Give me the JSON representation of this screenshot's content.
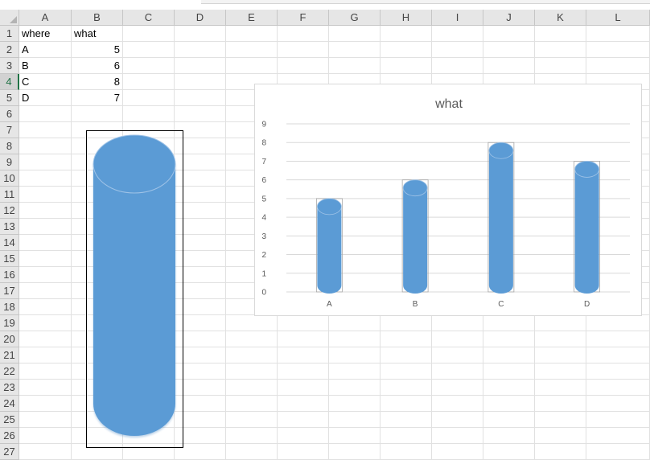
{
  "columns": [
    "A",
    "B",
    "C",
    "D",
    "E",
    "F",
    "G",
    "H",
    "I",
    "J",
    "K",
    "L"
  ],
  "rows": [
    "1",
    "2",
    "3",
    "4",
    "5",
    "6",
    "7",
    "8",
    "9",
    "10",
    "11",
    "12",
    "13",
    "14",
    "15",
    "16",
    "17",
    "18",
    "19",
    "20",
    "21",
    "22",
    "23",
    "24",
    "25",
    "26",
    "27"
  ],
  "active_row": "4",
  "cells": [
    {
      "ref": "A1",
      "text": "where",
      "type": "text"
    },
    {
      "ref": "B1",
      "text": "what",
      "type": "text"
    },
    {
      "ref": "A2",
      "text": "A",
      "type": "text"
    },
    {
      "ref": "B2",
      "text": "5",
      "type": "num"
    },
    {
      "ref": "A3",
      "text": "B",
      "type": "text"
    },
    {
      "ref": "B3",
      "text": "6",
      "type": "num"
    },
    {
      "ref": "A4",
      "text": "C",
      "type": "text"
    },
    {
      "ref": "B4",
      "text": "8",
      "type": "num"
    },
    {
      "ref": "A5",
      "text": "D",
      "type": "text"
    },
    {
      "ref": "B5",
      "text": "7",
      "type": "num"
    }
  ],
  "colors": {
    "bar_fill": "#5b9bd5",
    "bar_top": "#6aa6dc",
    "grid": "#d9d9d9",
    "text": "#595959"
  },
  "chart_data": {
    "type": "bar",
    "bar_shape": "cylinder",
    "title": "what",
    "categories": [
      "A",
      "B",
      "C",
      "D"
    ],
    "series": [
      {
        "name": "what",
        "values": [
          5,
          6,
          8,
          7
        ]
      }
    ],
    "ylim": [
      0,
      9
    ],
    "yticks": [
      0,
      1,
      2,
      3,
      4,
      5,
      6,
      7,
      8,
      9
    ],
    "grid": true,
    "legend": "none"
  }
}
